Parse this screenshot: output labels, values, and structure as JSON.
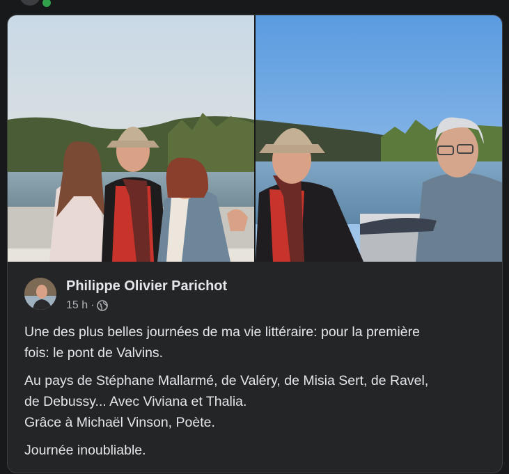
{
  "post": {
    "author": {
      "name": "Philippe Olivier Parichot"
    },
    "meta": {
      "time": "15 h",
      "separator": "·",
      "audience_icon": "globe-icon"
    },
    "paragraphs": [
      [
        "Une des plus belles journées de ma vie littéraire: pour la première",
        "fois: le pont de Valvins."
      ],
      [
        "Au pays de Stéphane Mallarmé, de Valéry, de Misia Sert, de Ravel,",
        "de Debussy... Avec Viviana et Thalia.",
        "Grâce à Michaël Vinson, Poète."
      ],
      [
        "Journée inoubliable."
      ]
    ],
    "photos": [
      {
        "name": "photo-three-people-riverside"
      },
      {
        "name": "photo-two-men-riverside"
      }
    ]
  },
  "colors": {
    "background": "#18191a",
    "card": "#242526",
    "text_primary": "#e4e6eb",
    "text_secondary": "#b0b3b8",
    "online": "#31a24c"
  }
}
